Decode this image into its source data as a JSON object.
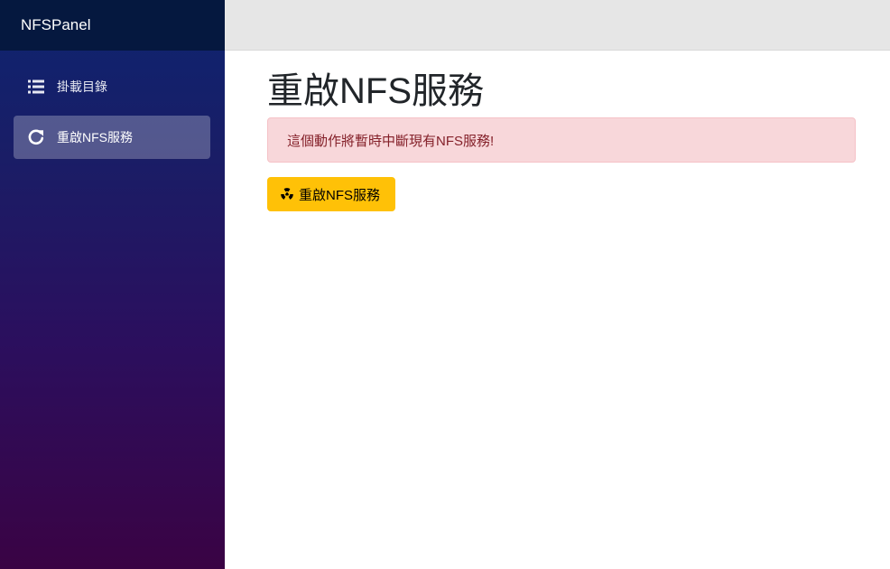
{
  "app": {
    "brand": "NFSPanel"
  },
  "sidebar": {
    "items": [
      {
        "label": "掛載目錄",
        "icon": "list-icon",
        "active": false
      },
      {
        "label": "重啟NFS服務",
        "icon": "refresh-icon",
        "active": true
      }
    ]
  },
  "main": {
    "title": "重啟NFS服務",
    "alert": "這個動作將暫時中斷現有NFS服務!",
    "restart_button": {
      "label": "重啟NFS服務",
      "icon": "radiation-icon"
    }
  },
  "colors": {
    "brand_bar": "#05183f",
    "sidebar_top": "#0d2470",
    "sidebar_bottom": "#3a0344",
    "alert_bg": "#f8d7da",
    "alert_text": "#842029",
    "button_warning": "#ffc107"
  }
}
